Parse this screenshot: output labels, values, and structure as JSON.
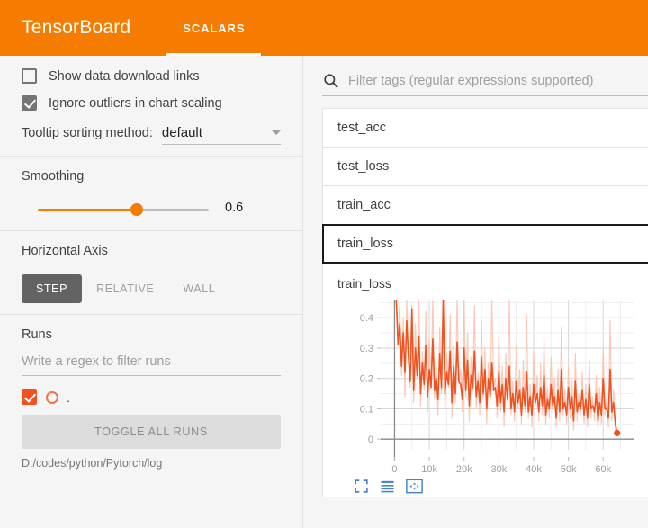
{
  "header": {
    "brand": "TensorBoard",
    "tabs": [
      {
        "label": "SCALARS",
        "active": true
      }
    ]
  },
  "sidebar": {
    "checkboxes": [
      {
        "label": "Show data download links",
        "checked": false
      },
      {
        "label": "Ignore outliers in chart scaling",
        "checked": true
      }
    ],
    "tooltip": {
      "label": "Tooltip sorting method:",
      "value": "default"
    },
    "smoothing": {
      "title": "Smoothing",
      "value": "0.6",
      "percent": 58
    },
    "horizontal_axis": {
      "title": "Horizontal Axis",
      "options": [
        {
          "label": "STEP",
          "active": true
        },
        {
          "label": "RELATIVE",
          "active": false
        },
        {
          "label": "WALL",
          "active": false
        }
      ]
    },
    "runs": {
      "title": "Runs",
      "filter_placeholder": "Write a regex to filter runs",
      "items": [
        {
          "name": ".",
          "checked": true,
          "color": "#f4511e"
        }
      ],
      "toggle_all_label": "TOGGLE ALL RUNS",
      "logdir": "D:/codes/python/Pytorch/log"
    }
  },
  "main": {
    "search": {
      "placeholder": "Filter tags (regular expressions supported)",
      "value": ""
    },
    "tags": [
      {
        "label": "test_acc",
        "selected": false
      },
      {
        "label": "test_loss",
        "selected": false
      },
      {
        "label": "train_acc",
        "selected": false
      },
      {
        "label": "train_loss",
        "selected": true
      }
    ],
    "chart_card": {
      "title": "train_loss",
      "toolbar": [
        {
          "name": "expand-icon",
          "label": "Fit / expand chart"
        },
        {
          "name": "data-table-icon",
          "label": "Toggle data table"
        },
        {
          "name": "fit-domain-icon",
          "label": "Fit domain to data"
        }
      ]
    }
  },
  "colors": {
    "brand_orange": "#f57c00",
    "series_orange": "#f4511e",
    "series_orange_faded": "#fbc0ac",
    "toolbar_blue": "#4285c8",
    "toggle_active": "#636363"
  },
  "chart_data": {
    "type": "line",
    "title": "train_loss",
    "xlabel": "",
    "ylabel": "",
    "xlim": [
      -4000,
      69000
    ],
    "ylim": [
      -0.035,
      0.46
    ],
    "xticks": [
      0,
      10000,
      20000,
      30000,
      40000,
      50000,
      60000
    ],
    "xticklabels": [
      "0",
      "10k",
      "20k",
      "30k",
      "40k",
      "50k",
      "60k"
    ],
    "yticks": [
      0,
      0.1,
      0.2,
      0.3,
      0.4
    ],
    "yticklabels": [
      "0",
      "0.1",
      "0.2",
      "0.3",
      "0.4"
    ],
    "grid": true,
    "legend": false,
    "series": [
      {
        "name": "train_loss (raw)",
        "color": "#fbc0ac",
        "smoothed": false,
        "x": [
          500,
          1000,
          1500,
          2000,
          2500,
          3000,
          3500,
          4000,
          4500,
          5000,
          5500,
          6000,
          6500,
          7000,
          7500,
          8000,
          8500,
          9000,
          9500,
          10000,
          10500,
          11000,
          11500,
          12000,
          12500,
          13000,
          13500,
          14000,
          14500,
          15000,
          15500,
          16000,
          16500,
          17000,
          17500,
          18000,
          18500,
          19000,
          19500,
          20000,
          20500,
          21000,
          21500,
          22000,
          22500,
          23000,
          23500,
          24000,
          24500,
          25000,
          25500,
          26000,
          26500,
          27000,
          27500,
          28000,
          28500,
          29000,
          29500,
          30000,
          30500,
          31000,
          31500,
          32000,
          32500,
          33000,
          33500,
          34000,
          34500,
          35000,
          35500,
          36000,
          36500,
          37000,
          37500,
          38000,
          38500,
          39000,
          39500,
          40000,
          40500,
          41000,
          41500,
          42000,
          42500,
          43000,
          43500,
          44000,
          44500,
          45000,
          45500,
          46000,
          46500,
          47000,
          47500,
          48000,
          48500,
          49000,
          49500,
          50000,
          50500,
          51000,
          51500,
          52000,
          52500,
          53000,
          53500,
          54000,
          54500,
          55000,
          55500,
          56000,
          56500,
          57000,
          57500,
          58000,
          58500,
          59000,
          59500,
          60000,
          60500,
          61000,
          61500,
          62000,
          62500,
          63000,
          63500,
          64000
        ],
        "y": [
          0.46,
          0.33,
          0.45,
          0.21,
          0.4,
          0.14,
          0.46,
          0.25,
          0.17,
          0.44,
          0.12,
          0.38,
          0.2,
          0.46,
          0.11,
          0.29,
          0.16,
          0.42,
          0.09,
          0.33,
          0.18,
          0.46,
          0.13,
          0.24,
          0.08,
          0.37,
          0.15,
          0.46,
          0.1,
          0.28,
          0.17,
          0.41,
          0.07,
          0.31,
          0.12,
          0.46,
          0.19,
          0.23,
          0.09,
          0.46,
          0.14,
          0.35,
          0.06,
          0.27,
          0.16,
          0.44,
          0.1,
          0.22,
          0.08,
          0.39,
          0.13,
          0.3,
          0.05,
          0.25,
          0.11,
          0.46,
          0.17,
          0.2,
          0.07,
          0.34,
          0.09,
          0.24,
          0.04,
          0.28,
          0.12,
          0.46,
          0.08,
          0.19,
          0.06,
          0.31,
          0.1,
          0.23,
          0.05,
          0.26,
          0.09,
          0.41,
          0.07,
          0.18,
          0.04,
          0.29,
          0.11,
          0.21,
          0.06,
          0.25,
          0.08,
          0.33,
          0.05,
          0.17,
          0.07,
          0.27,
          0.09,
          0.2,
          0.04,
          0.23,
          0.06,
          0.37,
          0.08,
          0.16,
          0.05,
          0.24,
          0.07,
          0.19,
          0.03,
          0.28,
          0.06,
          0.15,
          0.08,
          0.22,
          0.05,
          0.18,
          0.04,
          0.26,
          0.07,
          0.14,
          0.06,
          0.21,
          0.03,
          0.17,
          0.05,
          0.3,
          0.08,
          0.13,
          0.04,
          0.39,
          0.06,
          0.16,
          0.03,
          0.02
        ]
      },
      {
        "name": "train_loss (smoothed)",
        "color": "#f4511e",
        "smoothed": true,
        "x": [
          500,
          1000,
          1500,
          2000,
          2500,
          3000,
          3500,
          4000,
          4500,
          5000,
          5500,
          6000,
          6500,
          7000,
          7500,
          8000,
          8500,
          9000,
          9500,
          10000,
          10500,
          11000,
          11500,
          12000,
          12500,
          13000,
          13500,
          14000,
          14500,
          15000,
          15500,
          16000,
          16500,
          17000,
          17500,
          18000,
          18500,
          19000,
          19500,
          20000,
          20500,
          21000,
          21500,
          22000,
          22500,
          23000,
          23500,
          24000,
          24500,
          25000,
          25500,
          26000,
          26500,
          27000,
          27500,
          28000,
          28500,
          29000,
          29500,
          30000,
          30500,
          31000,
          31500,
          32000,
          32500,
          33000,
          33500,
          34000,
          34500,
          35000,
          35500,
          36000,
          36500,
          37000,
          37500,
          38000,
          38500,
          39000,
          39500,
          40000,
          40500,
          41000,
          41500,
          42000,
          42500,
          43000,
          43500,
          44000,
          44500,
          45000,
          45500,
          46000,
          46500,
          47000,
          47500,
          48000,
          48500,
          49000,
          49500,
          50000,
          50500,
          51000,
          51500,
          52000,
          52500,
          53000,
          53500,
          54000,
          54500,
          55000,
          55500,
          56000,
          56500,
          57000,
          57500,
          58000,
          58500,
          59000,
          59500,
          60000,
          60500,
          61000,
          61500,
          62000,
          62500,
          63000,
          63500,
          64000
        ],
        "y": [
          0.46,
          0.31,
          0.38,
          0.24,
          0.35,
          0.22,
          0.39,
          0.27,
          0.19,
          0.43,
          0.16,
          0.3,
          0.21,
          0.34,
          0.15,
          0.25,
          0.18,
          0.31,
          0.14,
          0.23,
          0.17,
          0.33,
          0.16,
          0.2,
          0.13,
          0.28,
          0.17,
          0.46,
          0.15,
          0.22,
          0.18,
          0.29,
          0.12,
          0.24,
          0.15,
          0.32,
          0.19,
          0.18,
          0.13,
          0.3,
          0.16,
          0.26,
          0.11,
          0.21,
          0.17,
          0.29,
          0.14,
          0.19,
          0.12,
          0.27,
          0.15,
          0.23,
          0.1,
          0.2,
          0.14,
          0.25,
          0.16,
          0.17,
          0.11,
          0.22,
          0.12,
          0.18,
          0.09,
          0.2,
          0.13,
          0.24,
          0.1,
          0.15,
          0.09,
          0.19,
          0.12,
          0.16,
          0.08,
          0.17,
          0.11,
          0.22,
          0.09,
          0.14,
          0.08,
          0.18,
          0.12,
          0.15,
          0.09,
          0.17,
          0.11,
          0.21,
          0.08,
          0.13,
          0.1,
          0.18,
          0.11,
          0.14,
          0.07,
          0.16,
          0.09,
          0.23,
          0.1,
          0.12,
          0.08,
          0.17,
          0.1,
          0.14,
          0.06,
          0.19,
          0.09,
          0.12,
          0.1,
          0.16,
          0.08,
          0.13,
          0.07,
          0.18,
          0.1,
          0.11,
          0.09,
          0.15,
          0.06,
          0.12,
          0.08,
          0.2,
          0.1,
          0.1,
          0.07,
          0.23,
          0.09,
          0.12,
          0.05,
          0.02
        ]
      }
    ],
    "endpoint": {
      "x": 64000,
      "y": 0.02,
      "color": "#f4511e"
    }
  }
}
